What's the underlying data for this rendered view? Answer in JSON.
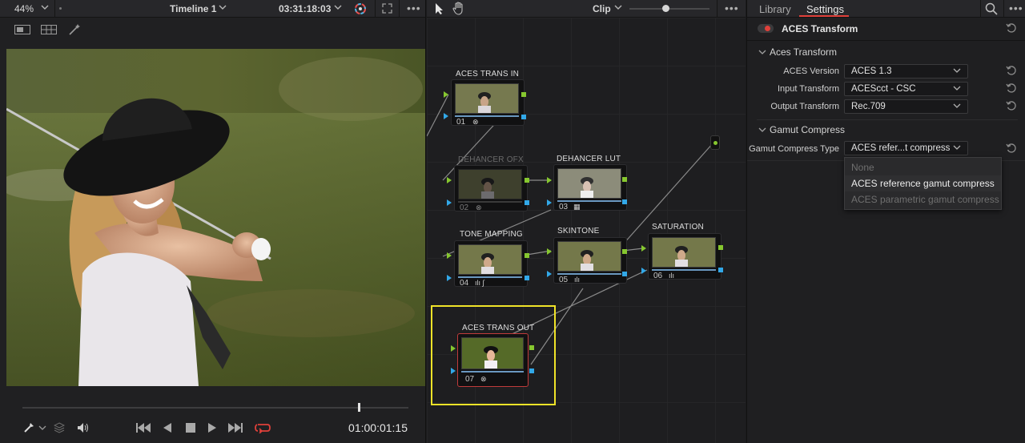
{
  "viewer": {
    "zoom": "44%",
    "timeline": "Timeline 1",
    "source_timecode": "03:31:18:03",
    "record_timecode": "01:00:01:15",
    "playhead_fraction": 0.87
  },
  "node_editor": {
    "title": "Clip",
    "nodes": [
      {
        "label": "ACES TRANS IN",
        "num": "01",
        "glyph": "⊗",
        "state": "enabled"
      },
      {
        "label": "DEHANCER OFX",
        "num": "02",
        "glyph": "⊗",
        "state": "disabled"
      },
      {
        "label": "DEHANCER LUT",
        "num": "03",
        "glyph": "▦",
        "state": "enabled"
      },
      {
        "label": "TONE MAPPING",
        "num": "04",
        "glyph": "ılı ∫",
        "state": "enabled"
      },
      {
        "label": "SKINTONE",
        "num": "05",
        "glyph": "ılı",
        "state": "enabled"
      },
      {
        "label": "SATURATION",
        "num": "06",
        "glyph": "ılı",
        "state": "enabled"
      },
      {
        "label": "ACES TRANS OUT",
        "num": "07",
        "glyph": "⊗",
        "state": "selected"
      }
    ]
  },
  "inspector": {
    "tabs": [
      "Library",
      "Settings"
    ],
    "active_tab": "Settings",
    "effect_title": "ACES Transform",
    "sections": {
      "aces_transform": "Aces Transform",
      "gamut_compress": "Gamut Compress"
    },
    "fields": {
      "aces_version": {
        "label": "ACES Version",
        "value": "ACES 1.3"
      },
      "input_transform": {
        "label": "Input Transform",
        "value": "ACEScct - CSC"
      },
      "output_transform": {
        "label": "Output Transform",
        "value": "Rec.709"
      },
      "gamut_compress_type": {
        "label": "Gamut Compress Type",
        "value": "ACES refer...t compress"
      }
    },
    "dropdown": {
      "options": [
        "None",
        "ACES reference gamut compress",
        "ACES parametric gamut compress"
      ],
      "highlighted": "ACES reference gamut compress"
    }
  },
  "colors": {
    "accent_red": "#e0403a",
    "selection_yellow": "#f0e328",
    "port_green": "#86c72f",
    "port_blue": "#32a8e8"
  }
}
